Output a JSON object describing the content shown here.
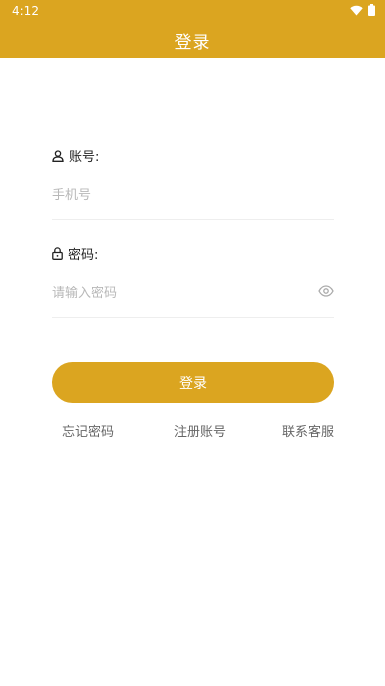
{
  "status_bar": {
    "time": "4:12"
  },
  "app_bar": {
    "title": "登录"
  },
  "account": {
    "label": "账号:",
    "placeholder": "手机号",
    "value": ""
  },
  "password": {
    "label": "密码:",
    "placeholder": "请输入密码",
    "value": ""
  },
  "login_button": {
    "label": "登录"
  },
  "links": {
    "forgot": "忘记密码",
    "register": "注册账号",
    "contact": "联系客服"
  },
  "colors": {
    "accent": "#DBA520",
    "placeholder": "#b8b8b8",
    "link": "#666666"
  },
  "icons": {
    "account": "user-icon",
    "password": "lock-icon",
    "toggle": "eye-icon"
  }
}
